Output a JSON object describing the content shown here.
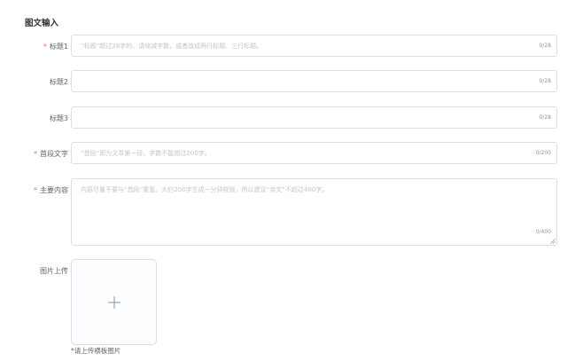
{
  "section": {
    "title": "图文输入"
  },
  "fields": {
    "title1": {
      "label": "标题1",
      "required": true,
      "placeholder": "“标题”超过28字的，请缩减字数，或者改成两行标题、三行标题。",
      "counter": "0/28"
    },
    "title2": {
      "label": "标题2",
      "required": false,
      "placeholder": "",
      "counter": "0/28"
    },
    "title3": {
      "label": "标题3",
      "required": false,
      "placeholder": "",
      "counter": "0/28"
    },
    "first_paragraph": {
      "label": "首段文字",
      "required": true,
      "placeholder": "“首段”即为文章第一段，字数不能超过200字。",
      "counter": "0/200"
    },
    "main_content": {
      "label": "主要内容",
      "required": true,
      "placeholder": "内容尽量不要与“首段”重复。大约200字生成一分钟视频，所以建议“余文”不超过400字。",
      "counter": "0/400"
    }
  },
  "upload": {
    "label": "图片上传",
    "hint": "*请上传横板图片",
    "icon": "plus-icon"
  },
  "colors": {
    "required_mark": "#f56c6c",
    "border": "#dcdfe6",
    "placeholder": "#c0c4cc"
  }
}
